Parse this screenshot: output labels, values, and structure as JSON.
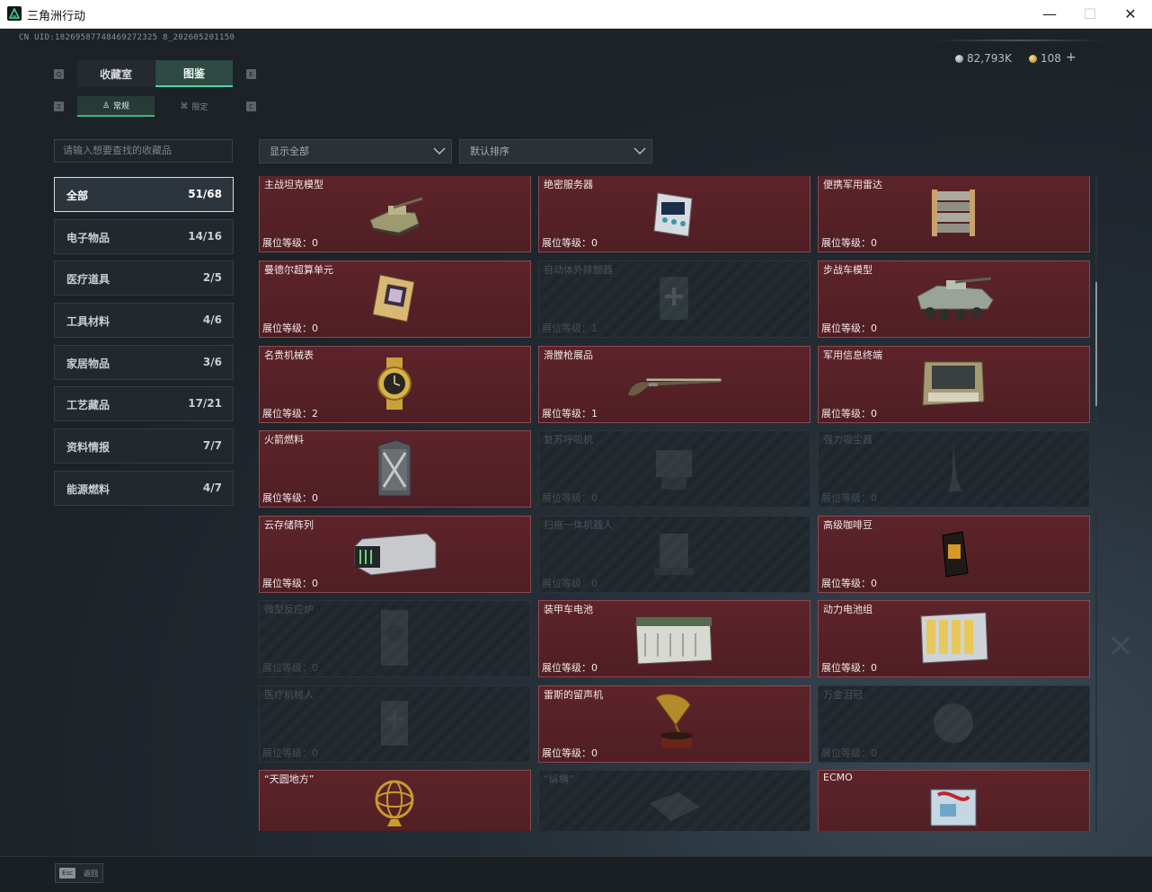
{
  "window": {
    "title": "三角洲行动",
    "minimize": "—",
    "maximize": "☐",
    "close": "✕"
  },
  "header": {
    "uid": "CN UID:18269587748469272325 8_202605201150",
    "currency_silver": "82,793K",
    "currency_gold": "108",
    "plus": "+"
  },
  "tabs": {
    "main": [
      {
        "label": "收藏室",
        "active": false
      },
      {
        "label": "图鉴",
        "active": true
      }
    ],
    "sub": [
      {
        "label": "常规",
        "active": true
      },
      {
        "label": "限定",
        "active": false
      }
    ],
    "key_left_main": "Q",
    "key_right_main": "E",
    "key_left_sub": "Z",
    "key_right_sub": "C"
  },
  "search": {
    "placeholder": "请输入想要查找的收藏品"
  },
  "filters": {
    "show": "显示全部",
    "sort": "默认排序"
  },
  "categories": [
    {
      "name": "全部",
      "count": "51/68",
      "active": true
    },
    {
      "name": "电子物品",
      "count": "14/16"
    },
    {
      "name": "医疗道具",
      "count": "2/5"
    },
    {
      "name": "工具材料",
      "count": "4/6"
    },
    {
      "name": "家居物品",
      "count": "3/6"
    },
    {
      "name": "工艺藏品",
      "count": "17/21"
    },
    {
      "name": "资料情报",
      "count": "7/7"
    },
    {
      "name": "能源燃料",
      "count": "4/7"
    }
  ],
  "items": [
    {
      "name": "主战坦克模型",
      "level": "展位等级：0",
      "owned": true,
      "icon": "tank-model-icon"
    },
    {
      "name": "绝密服务器",
      "level": "展位等级：0",
      "owned": true,
      "icon": "server-icon"
    },
    {
      "name": "便携军用雷达",
      "level": "展位等级：0",
      "owned": true,
      "icon": "radar-icon"
    },
    {
      "name": "曼德尔超算单元",
      "level": "展位等级：0",
      "owned": true,
      "icon": "cpu-board-icon"
    },
    {
      "name": "自动体外除颤器",
      "level": "展位等级：1",
      "owned": false,
      "icon": "defibrillator-icon"
    },
    {
      "name": "步战车模型",
      "level": "展位等级：0",
      "owned": true,
      "icon": "ifv-model-icon"
    },
    {
      "name": "名贵机械表",
      "level": "展位等级：2",
      "owned": true,
      "icon": "watch-icon"
    },
    {
      "name": "滑膛枪展品",
      "level": "展位等级：1",
      "owned": true,
      "icon": "musket-icon"
    },
    {
      "name": "军用信息终端",
      "level": "展位等级：0",
      "owned": true,
      "icon": "terminal-icon"
    },
    {
      "name": "火箭燃料",
      "level": "展位等级：0",
      "owned": true,
      "icon": "fuel-can-icon"
    },
    {
      "name": "复苏呼吸机",
      "level": "展位等级：0",
      "owned": false,
      "icon": "ventilator-icon"
    },
    {
      "name": "强力吸尘器",
      "level": "展位等级：0",
      "owned": false,
      "icon": "vacuum-icon"
    },
    {
      "name": "云存储阵列",
      "level": "展位等级：0",
      "owned": true,
      "icon": "storage-array-icon"
    },
    {
      "name": "扫拖一体机器人",
      "level": "展位等级：0",
      "owned": false,
      "icon": "robot-vacuum-icon"
    },
    {
      "name": "高级咖啡豆",
      "level": "展位等级：0",
      "owned": true,
      "icon": "coffee-bag-icon"
    },
    {
      "name": "微型反应炉",
      "level": "展位等级：0",
      "owned": false,
      "icon": "reactor-icon"
    },
    {
      "name": "装甲车电池",
      "level": "展位等级：0",
      "owned": true,
      "icon": "battery-icon"
    },
    {
      "name": "动力电池组",
      "level": "展位等级：0",
      "owned": true,
      "icon": "battery-pack-icon"
    },
    {
      "name": "医疗机械人",
      "level": "展位等级：0",
      "owned": false,
      "icon": "medical-robot-icon"
    },
    {
      "name": "雷斯的留声机",
      "level": "展位等级：0",
      "owned": true,
      "icon": "gramophone-icon"
    },
    {
      "name": "万金泪冠",
      "level": "展位等级：0",
      "owned": false,
      "icon": "crown-icon"
    },
    {
      "name": "“天圆地方”",
      "level": "",
      "owned": true,
      "icon": "armillary-icon"
    },
    {
      "name": "“纵横”",
      "level": "",
      "owned": false,
      "icon": "board-icon"
    },
    {
      "name": "ECMO",
      "level": "",
      "owned": true,
      "icon": "ecmo-icon"
    }
  ],
  "footer": {
    "esc_key": "Esc",
    "esc_label": "返回"
  }
}
